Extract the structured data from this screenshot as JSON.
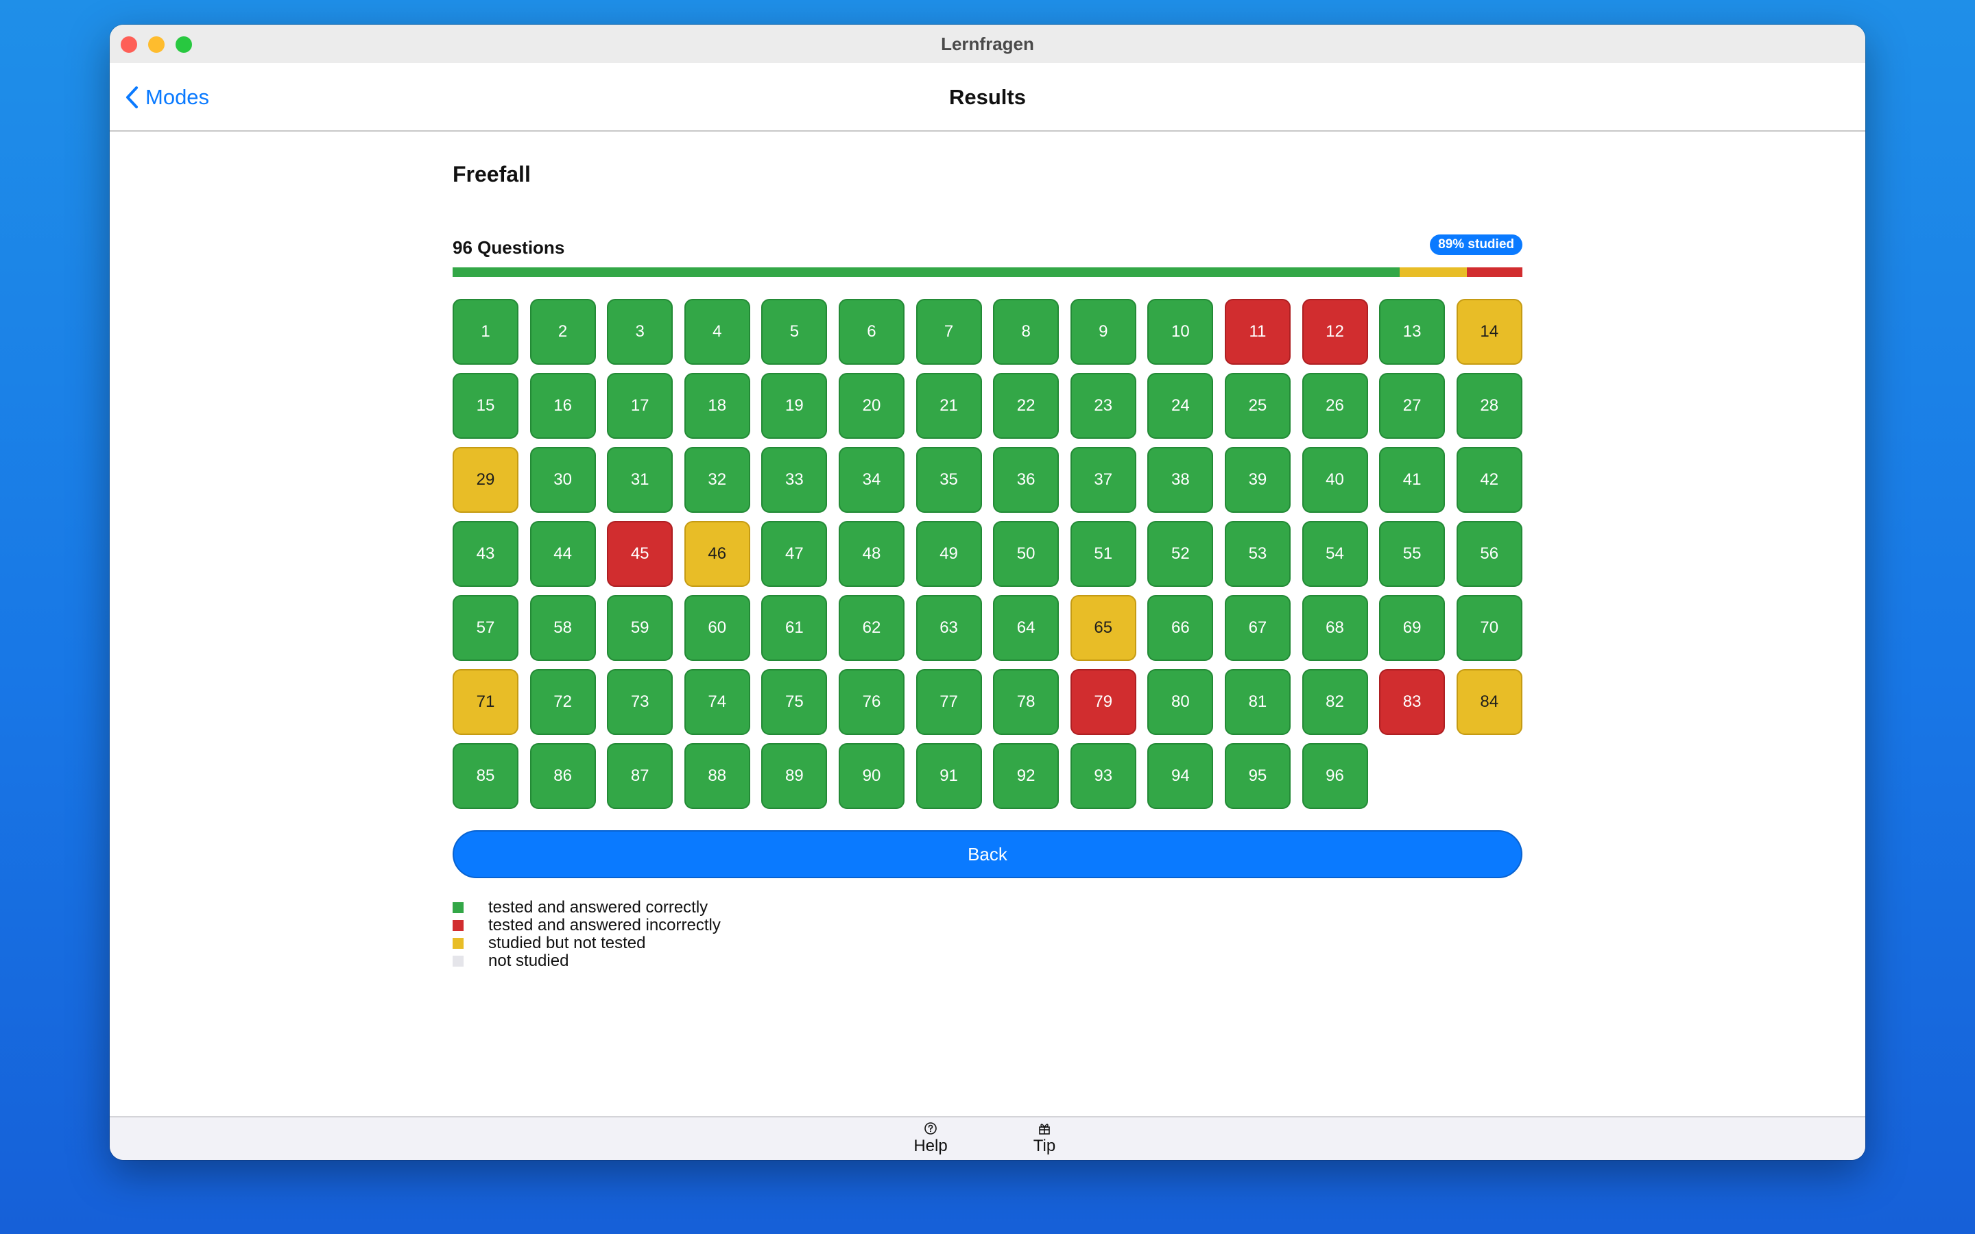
{
  "window": {
    "title": "Lernfragen"
  },
  "navbar": {
    "back_label": "Modes",
    "title": "Results"
  },
  "section": {
    "title": "Freefall",
    "question_count": "96 Questions",
    "studied_badge": "89% studied"
  },
  "progress": {
    "correct_pct": 88.5,
    "studied_pct": 6.3,
    "incorrect_pct": 5.2
  },
  "colors": {
    "correct": "#33a747",
    "incorrect": "#d12d2f",
    "studied": "#e8bd27",
    "not_studied": "#e5e5ea",
    "accent": "#0a7aff"
  },
  "questions": [
    {
      "n": "1",
      "s": "correct"
    },
    {
      "n": "2",
      "s": "correct"
    },
    {
      "n": "3",
      "s": "correct"
    },
    {
      "n": "4",
      "s": "correct"
    },
    {
      "n": "5",
      "s": "correct"
    },
    {
      "n": "6",
      "s": "correct"
    },
    {
      "n": "7",
      "s": "correct"
    },
    {
      "n": "8",
      "s": "correct"
    },
    {
      "n": "9",
      "s": "correct"
    },
    {
      "n": "10",
      "s": "correct"
    },
    {
      "n": "11",
      "s": "incorrect"
    },
    {
      "n": "12",
      "s": "incorrect"
    },
    {
      "n": "13",
      "s": "correct"
    },
    {
      "n": "14",
      "s": "studied"
    },
    {
      "n": "15",
      "s": "correct"
    },
    {
      "n": "16",
      "s": "correct"
    },
    {
      "n": "17",
      "s": "correct"
    },
    {
      "n": "18",
      "s": "correct"
    },
    {
      "n": "19",
      "s": "correct"
    },
    {
      "n": "20",
      "s": "correct"
    },
    {
      "n": "21",
      "s": "correct"
    },
    {
      "n": "22",
      "s": "correct"
    },
    {
      "n": "23",
      "s": "correct"
    },
    {
      "n": "24",
      "s": "correct"
    },
    {
      "n": "25",
      "s": "correct"
    },
    {
      "n": "26",
      "s": "correct"
    },
    {
      "n": "27",
      "s": "correct"
    },
    {
      "n": "28",
      "s": "correct"
    },
    {
      "n": "29",
      "s": "studied"
    },
    {
      "n": "30",
      "s": "correct"
    },
    {
      "n": "31",
      "s": "correct"
    },
    {
      "n": "32",
      "s": "correct"
    },
    {
      "n": "33",
      "s": "correct"
    },
    {
      "n": "34",
      "s": "correct"
    },
    {
      "n": "35",
      "s": "correct"
    },
    {
      "n": "36",
      "s": "correct"
    },
    {
      "n": "37",
      "s": "correct"
    },
    {
      "n": "38",
      "s": "correct"
    },
    {
      "n": "39",
      "s": "correct"
    },
    {
      "n": "40",
      "s": "correct"
    },
    {
      "n": "41",
      "s": "correct"
    },
    {
      "n": "42",
      "s": "correct"
    },
    {
      "n": "43",
      "s": "correct"
    },
    {
      "n": "44",
      "s": "correct"
    },
    {
      "n": "45",
      "s": "incorrect"
    },
    {
      "n": "46",
      "s": "studied"
    },
    {
      "n": "47",
      "s": "correct"
    },
    {
      "n": "48",
      "s": "correct"
    },
    {
      "n": "49",
      "s": "correct"
    },
    {
      "n": "50",
      "s": "correct"
    },
    {
      "n": "51",
      "s": "correct"
    },
    {
      "n": "52",
      "s": "correct"
    },
    {
      "n": "53",
      "s": "correct"
    },
    {
      "n": "54",
      "s": "correct"
    },
    {
      "n": "55",
      "s": "correct"
    },
    {
      "n": "56",
      "s": "correct"
    },
    {
      "n": "57",
      "s": "correct"
    },
    {
      "n": "58",
      "s": "correct"
    },
    {
      "n": "59",
      "s": "correct"
    },
    {
      "n": "60",
      "s": "correct"
    },
    {
      "n": "61",
      "s": "correct"
    },
    {
      "n": "62",
      "s": "correct"
    },
    {
      "n": "63",
      "s": "correct"
    },
    {
      "n": "64",
      "s": "correct"
    },
    {
      "n": "65",
      "s": "studied"
    },
    {
      "n": "66",
      "s": "correct"
    },
    {
      "n": "67",
      "s": "correct"
    },
    {
      "n": "68",
      "s": "correct"
    },
    {
      "n": "69",
      "s": "correct"
    },
    {
      "n": "70",
      "s": "correct"
    },
    {
      "n": "71",
      "s": "studied"
    },
    {
      "n": "72",
      "s": "correct"
    },
    {
      "n": "73",
      "s": "correct"
    },
    {
      "n": "74",
      "s": "correct"
    },
    {
      "n": "75",
      "s": "correct"
    },
    {
      "n": "76",
      "s": "correct"
    },
    {
      "n": "77",
      "s": "correct"
    },
    {
      "n": "78",
      "s": "correct"
    },
    {
      "n": "79",
      "s": "incorrect"
    },
    {
      "n": "80",
      "s": "correct"
    },
    {
      "n": "81",
      "s": "correct"
    },
    {
      "n": "82",
      "s": "correct"
    },
    {
      "n": "83",
      "s": "incorrect"
    },
    {
      "n": "84",
      "s": "studied"
    },
    {
      "n": "85",
      "s": "correct"
    },
    {
      "n": "86",
      "s": "correct"
    },
    {
      "n": "87",
      "s": "correct"
    },
    {
      "n": "88",
      "s": "correct"
    },
    {
      "n": "89",
      "s": "correct"
    },
    {
      "n": "90",
      "s": "correct"
    },
    {
      "n": "91",
      "s": "correct"
    },
    {
      "n": "92",
      "s": "correct"
    },
    {
      "n": "93",
      "s": "correct"
    },
    {
      "n": "94",
      "s": "correct"
    },
    {
      "n": "95",
      "s": "correct"
    },
    {
      "n": "96",
      "s": "correct"
    }
  ],
  "back_button": {
    "label": "Back"
  },
  "legend": [
    {
      "label": "tested and answered correctly",
      "color": "#33a747"
    },
    {
      "label": "tested and answered incorrectly",
      "color": "#d12d2f"
    },
    {
      "label": "studied but not tested",
      "color": "#e8bd27"
    },
    {
      "label": "not studied",
      "color": "#e5e5ea"
    }
  ],
  "bottombar": {
    "help": {
      "label": "Help",
      "icon": "question-circle-icon"
    },
    "tip": {
      "label": "Tip",
      "icon": "gift-icon"
    }
  }
}
